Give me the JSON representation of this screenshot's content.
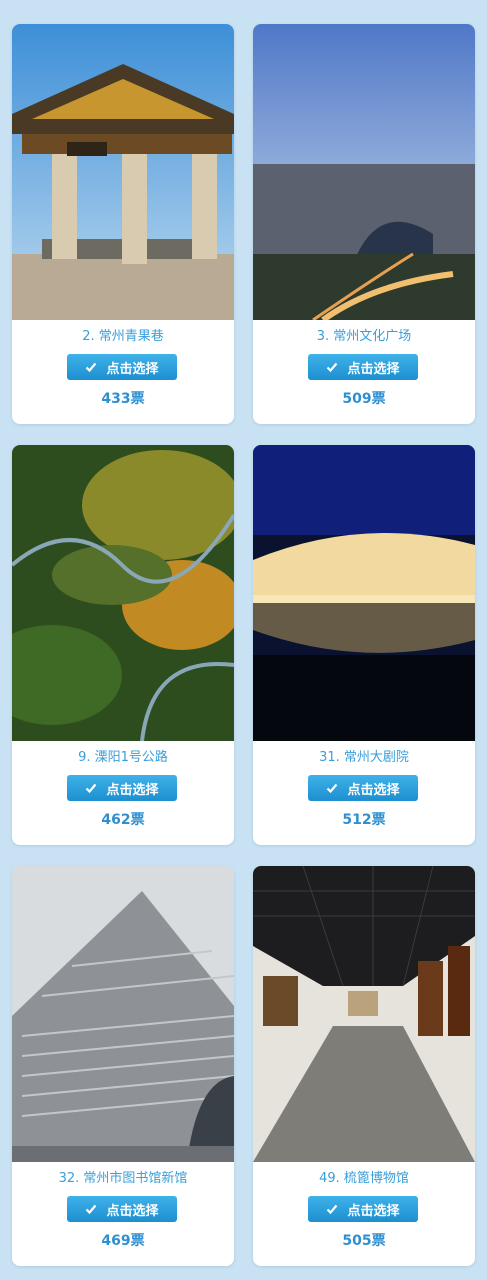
{
  "colors": {
    "page_bg": "#c9e2f3",
    "accent": "#3a9ed9",
    "button": "#2aa3e3"
  },
  "button_icon": "check-icon",
  "cards": [
    {
      "name": "2. 常州青果巷",
      "button_label": "点击选择",
      "votes": "433",
      "votes_unit": "票"
    },
    {
      "name": "3. 常州文化广场",
      "button_label": "点击选择",
      "votes": "509",
      "votes_unit": "票"
    },
    {
      "name": "9. 溧阳1号公路",
      "button_label": "点击选择",
      "votes": "462",
      "votes_unit": "票"
    },
    {
      "name": "31. 常州大剧院",
      "button_label": "点击选择",
      "votes": "512",
      "votes_unit": "票"
    },
    {
      "name": "32. 常州市图书馆新馆",
      "button_label": "点击选择",
      "votes": "469",
      "votes_unit": "票"
    },
    {
      "name": "49. 梳篦博物馆",
      "button_label": "点击选择",
      "votes": "505",
      "votes_unit": "票"
    }
  ]
}
